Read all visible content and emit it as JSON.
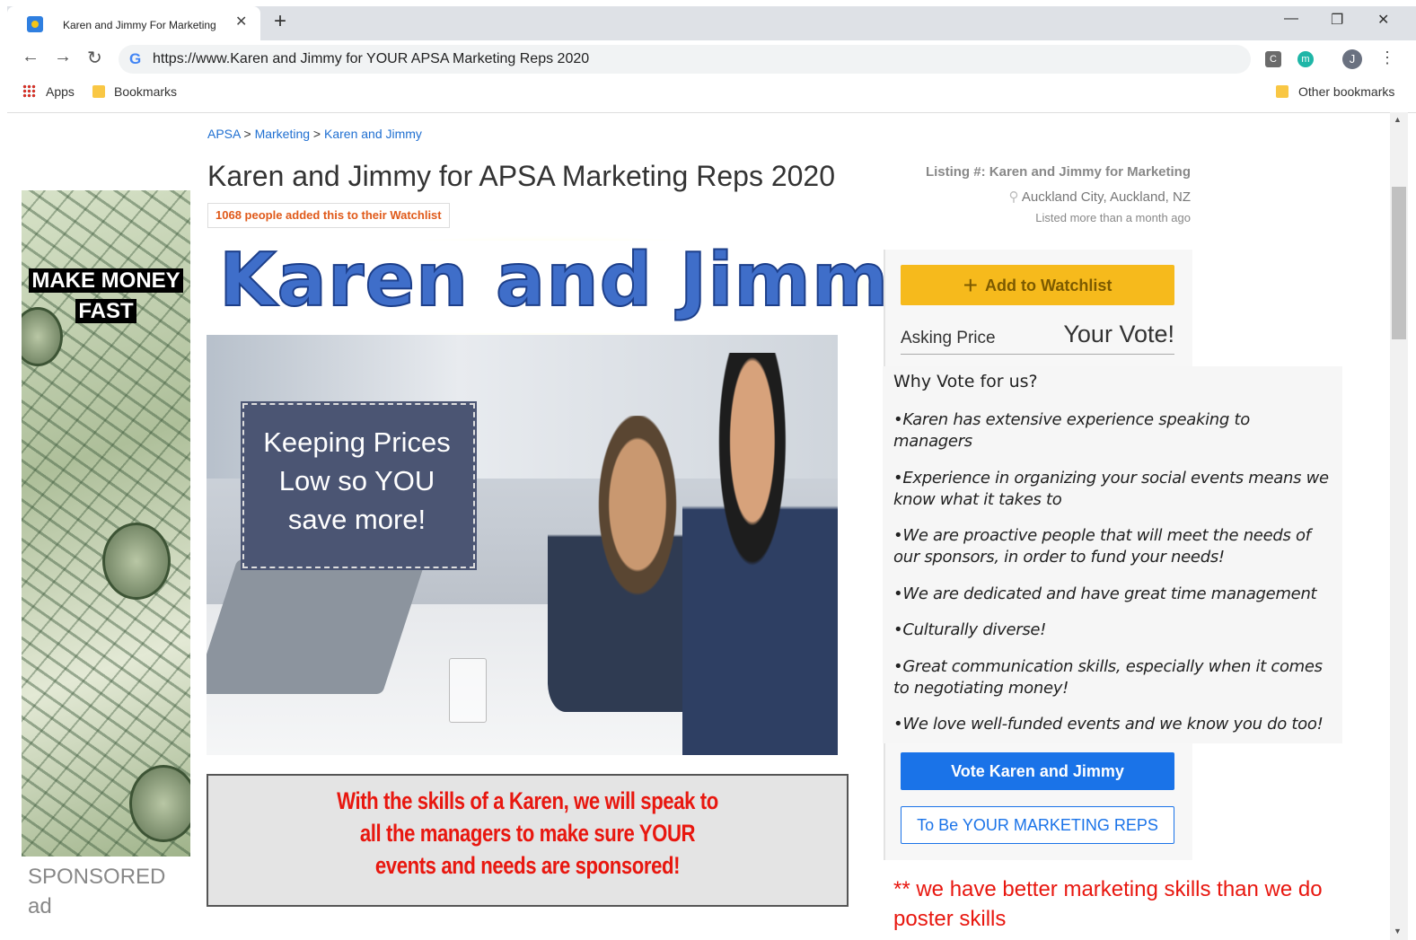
{
  "browser": {
    "tab_title": "Karen and Jimmy For Marketing",
    "url": "https://www.Karen and Jimmy for YOUR APSA Marketing Reps 2020",
    "avatar_letter": "J",
    "ext_c_letter": "C",
    "ext_m_letter": "m",
    "bookmarks": {
      "apps": "Apps",
      "folder": "Bookmarks",
      "other": "Other bookmarks"
    }
  },
  "breadcrumb": {
    "item1": "APSA",
    "item2": "Marketing",
    "item3": "Karen and Jimmy",
    "sep": ">"
  },
  "page": {
    "title": "Karen and Jimmy for APSA Marketing Reps 2020",
    "watchlist_count": "1068 people added this to their Watchlist"
  },
  "ad": {
    "headline_line1": "MAKE MONEY",
    "headline_line2": "FAST",
    "label_line1": "SPONSORED",
    "label_line2": "ad"
  },
  "poster": {
    "logo_text": "Karen and Jimmy",
    "price_line1": "Keeping Prices",
    "price_line2": "Low so YOU",
    "price_line3": "save more!",
    "slogan_line1": "With the skills of a Karen, we will speak to",
    "slogan_line2": "all the managers to make sure YOUR",
    "slogan_line3": "events and needs are sponsored!"
  },
  "listing": {
    "number": "Listing #: Karen and Jimmy for Marketing",
    "location": "Auckland City, Auckland, NZ",
    "listed": "Listed more than a month ago"
  },
  "actions": {
    "watchlist_label": "Add to Watchlist",
    "asking_label": "Asking Price",
    "asking_value": "Your Vote!",
    "vote_label": "Vote Karen and Jimmy",
    "reps_label": "To Be YOUR MARKETING REPS"
  },
  "why": {
    "title": "Why Vote for us?",
    "items": [
      "•Karen has extensive experience speaking to managers",
      "•Experience in organizing your social events means we know what it takes to",
      "•We are proactive people that will meet the needs of our sponsors, in order to fund your needs!",
      "•We are dedicated and have great time management",
      "•Culturally diverse!",
      "•Great communication skills, especially when it comes to negotiating money!",
      "•We love well-funded events and we know you do too!"
    ]
  },
  "footnote": "** we have better marketing skills than we do poster skills",
  "colors": {
    "watchlist": "#f6ba1c",
    "vote": "#1a73e8",
    "slogan": "#e8170f",
    "link": "#1f6fd1"
  }
}
